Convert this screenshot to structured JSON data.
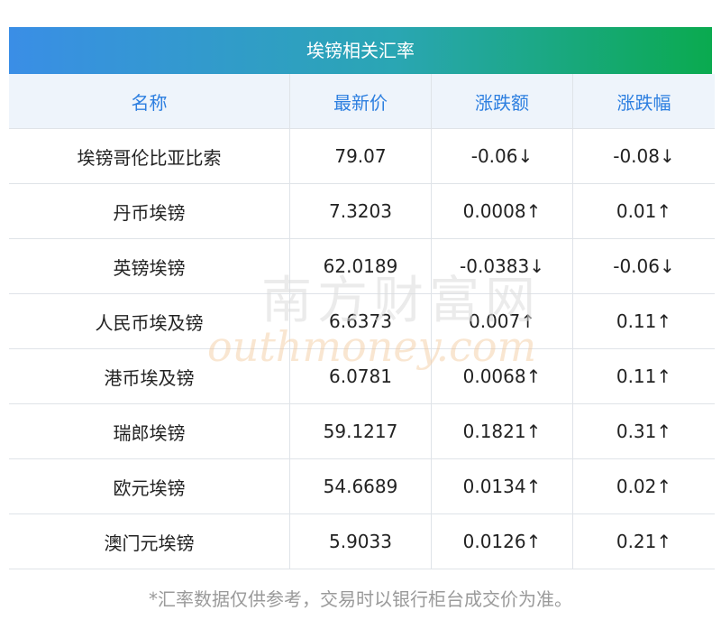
{
  "title": "埃镑相关汇率",
  "headers": {
    "name": "名称",
    "price": "最新价",
    "change": "涨跌额",
    "change_pct": "涨跌幅"
  },
  "rows": [
    {
      "name": "埃镑哥伦比亚比索",
      "price": "79.07",
      "change": "-0.06↓",
      "change_pct": "-0.08↓",
      "direction": "down"
    },
    {
      "name": "丹币埃镑",
      "price": "7.3203",
      "change": "0.0008↑",
      "change_pct": "0.01↑",
      "direction": "up"
    },
    {
      "name": "英镑埃镑",
      "price": "62.0189",
      "change": "-0.0383↓",
      "change_pct": "-0.06↓",
      "direction": "down"
    },
    {
      "name": "人民币埃及镑",
      "price": "6.6373",
      "change": "0.007↑",
      "change_pct": "0.11↑",
      "direction": "up"
    },
    {
      "name": "港币埃及镑",
      "price": "6.0781",
      "change": "0.0068↑",
      "change_pct": "0.11↑",
      "direction": "up"
    },
    {
      "name": "瑞郎埃镑",
      "price": "59.1217",
      "change": "0.1821↑",
      "change_pct": "0.31↑",
      "direction": "up"
    },
    {
      "name": "欧元埃镑",
      "price": "54.6689",
      "change": "0.0134↑",
      "change_pct": "0.02↑",
      "direction": "up"
    },
    {
      "name": "澳门元埃镑",
      "price": "5.9033",
      "change": "0.0126↑",
      "change_pct": "0.21↑",
      "direction": "up"
    }
  ],
  "watermark": {
    "cn": "南方财富网",
    "en": "outhmoney.com"
  },
  "footnote": "*汇率数据仅供参考，交易时以银行柜台成交价为准。",
  "colors": {
    "up": "#e60012",
    "down": "#0a8a1e",
    "header_text": "#2d7fe0"
  }
}
